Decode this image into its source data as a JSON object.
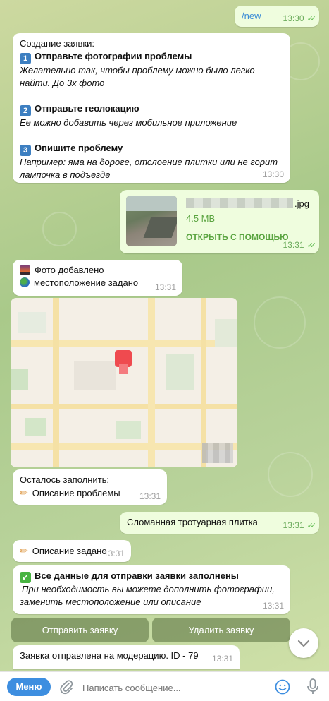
{
  "colors": {
    "accent": "#3d8ee0",
    "outgoing_bubble": "#effdde",
    "link": "#3a8cd6",
    "file_green": "#5aa440"
  },
  "messages": {
    "new_cmd": {
      "text": "/new",
      "time": "13:30"
    },
    "instructions": {
      "title": "Создание заявки:",
      "step1_num": "1",
      "step1_title": "Отправьте фотографии проблемы",
      "step1_desc1": "Желательно так, чтобы проблему можно было легко",
      "step1_desc2": "найти. До 3х фото",
      "step2_num": "2",
      "step2_title": "Отправьте геолокацию",
      "step2_desc": "Ее можно добавить через мобильное приложение",
      "step3_num": "3",
      "step3_title": "Опишите проблему",
      "step3_desc1": "Например: яма на дороге, отслоение плитки или не горит",
      "step3_desc2": "лампочка в подъезде",
      "time": "13:30"
    },
    "file": {
      "ext": ".jpg",
      "size": "4.5 MB",
      "open_with": "ОТКРЫТЬ С ПОМОЩЬЮ",
      "time": "13:31"
    },
    "photo_added": {
      "line1": "Фото добавлено",
      "line2": "местоположение задано",
      "time": "13:31"
    },
    "remaining": {
      "line1": "Осталось заполнить:",
      "line2": "Описание проблемы",
      "time": "13:31"
    },
    "user_desc": {
      "text": "Сломанная тротуарная плитка",
      "time": "13:31"
    },
    "desc_set": {
      "text": "Описание задано",
      "time": "13:31"
    },
    "all_filled": {
      "title": "Все данные для отправки заявки заполнены",
      "desc1": "При необходимость вы можете дополнить фотографии,",
      "desc2": "заменить местоположение или описание",
      "time": "13:31"
    },
    "submitted": {
      "text": "Заявка отправлена на модерацию. ID - 79",
      "time": "13:31"
    }
  },
  "buttons": {
    "send": "Отправить заявку",
    "delete": "Удалить заявку"
  },
  "composer": {
    "menu": "Меню",
    "placeholder": "Написать сообщение..."
  },
  "icons": {
    "photo": "sunset-photo-icon",
    "globe": "globe-icon",
    "pencil": "pencil-icon",
    "check": "check-icon",
    "scroll": "chevron-down-icon",
    "attach": "paperclip-icon",
    "emoji": "emoji-icon",
    "mic": "microphone-icon"
  }
}
